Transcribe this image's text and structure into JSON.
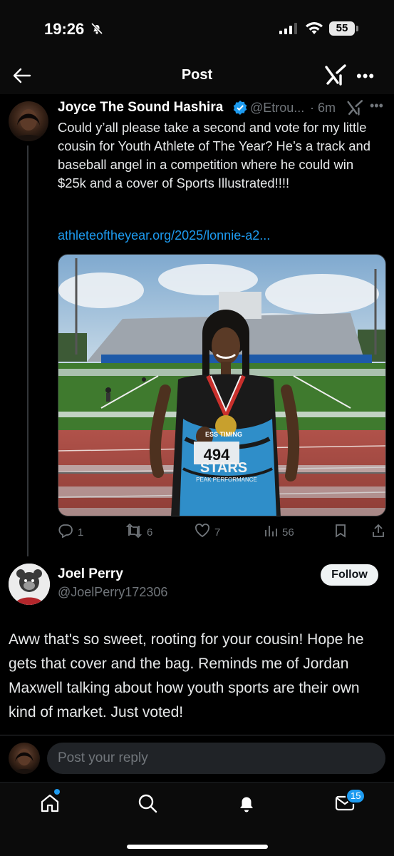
{
  "status_bar": {
    "time": "19:26",
    "battery": "55"
  },
  "header": {
    "title": "Post"
  },
  "tweet": {
    "author_name": "Joyce The Sound Hashira",
    "handle": "@Etrou...",
    "separator": "·",
    "time": "6m",
    "text": "Could y’all please take a second and vote for my little cousin for Youth Athlete of The Year? He’s a track and baseball angel in a competition where he could win $25k and a cover of Sports Illustrated!!!!",
    "link": "athleteoftheyear.org/2025/lonnie-a2...",
    "photo": {
      "bib": "494",
      "jersey_text": "STARS",
      "jersey_sub": "PEAK PERFORMANCE",
      "timing_label": "ESS TIMING"
    },
    "stats": {
      "replies": "1",
      "reposts": "6",
      "likes": "7",
      "views": "56"
    }
  },
  "reply": {
    "author_name": "Joel Perry",
    "handle": "@JoelPerry172306",
    "follow_label": "Follow",
    "text": "Aww that's so sweet, rooting for your cousin! Hope he gets that cover and the bag. Reminds me of Jordan Maxwell talking about how youth sports are their own kind of market. Just voted!"
  },
  "compose": {
    "placeholder": "Post your reply"
  },
  "tabbar": {
    "messages_badge": "15"
  },
  "icons": {
    "back": "back-arrow-icon",
    "grok": "grok-icon",
    "more": "more-icon",
    "reply": "reply-icon",
    "repost": "repost-icon",
    "like": "heart-icon",
    "views": "views-icon",
    "bookmark": "bookmark-icon",
    "share": "share-icon",
    "home": "home-icon",
    "search": "search-icon",
    "notifications": "bell-icon",
    "messages": "mail-icon"
  },
  "colors": {
    "background": "#000000",
    "accent": "#1d9bf0",
    "text": "#e7e9ea",
    "muted": "#71767b"
  }
}
